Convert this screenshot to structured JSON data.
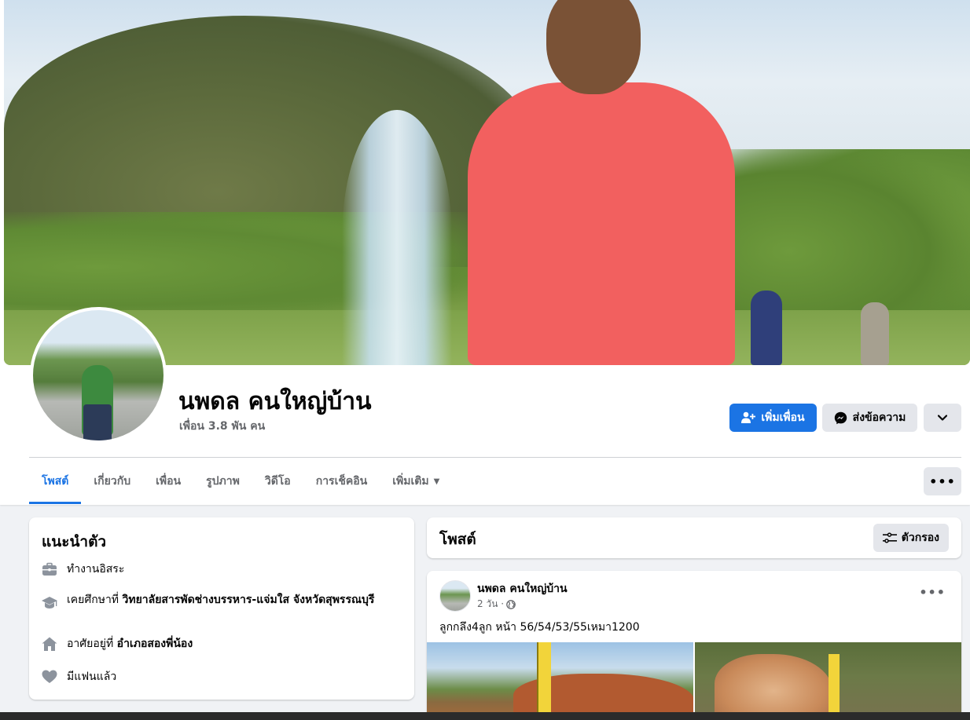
{
  "profile": {
    "name": "นพดล คนใหญ่บ้าน",
    "friends_count": "เพื่อน 3.8 พัน คน"
  },
  "actions": {
    "add_friend": "เพิ่มเพื่อน",
    "message": "ส่งข้อความ"
  },
  "tabs": [
    {
      "label": "โพสต์",
      "active": true
    },
    {
      "label": "เกี่ยวกับ"
    },
    {
      "label": "เพื่อน"
    },
    {
      "label": "รูปภาพ"
    },
    {
      "label": "วิดีโอ"
    },
    {
      "label": "การเช็คอิน"
    },
    {
      "label": "เพิ่มเติม"
    }
  ],
  "intro": {
    "title": "แนะนำตัว",
    "work": "ทำงานอิสระ",
    "education_prefix": "เคยศึกษาที่ ",
    "education_school": "วิทยาลัยสารพัดช่างบรรหาร-แจ่มใส จังหวัดสุพรรณบุรี",
    "lives_prefix": "อาศัยอยู่ที่ ",
    "lives_place": "อำเภอสองพี่น้อง",
    "relationship": "มีแฟนแล้ว"
  },
  "posts": {
    "title": "โพสต์",
    "filter_label": "ตัวกรอง",
    "items": [
      {
        "author": "นพดล คนใหญ่บ้าน",
        "time": "2 วัน ·",
        "text": "ลูกกลึง4ลูก หน้า 56/54/53/55เหมา1200"
      }
    ]
  },
  "colors": {
    "accent": "#1b74e4",
    "secondary_button": "#e4e6eb",
    "page_background": "#f0f2f5"
  }
}
